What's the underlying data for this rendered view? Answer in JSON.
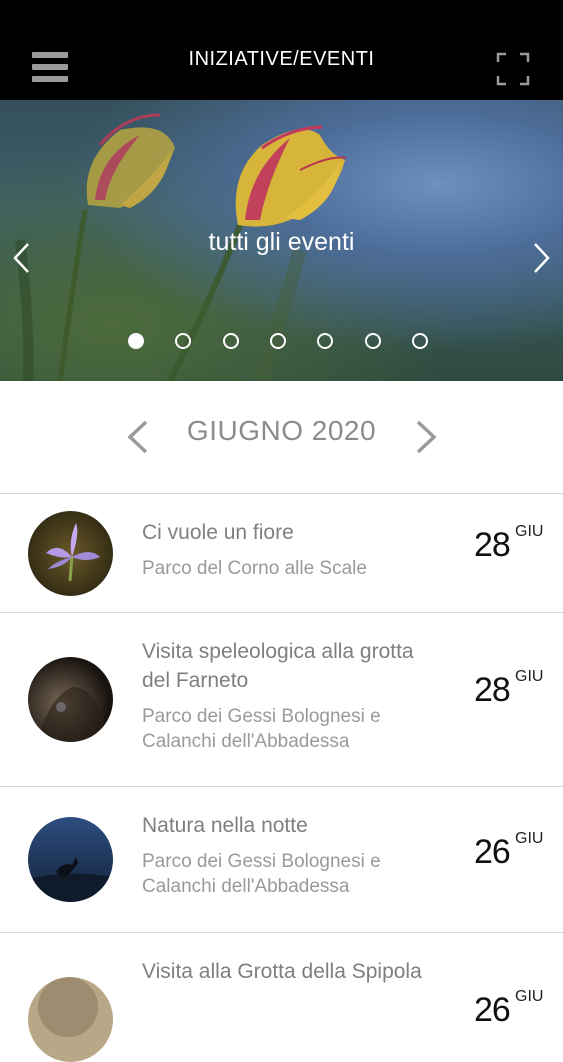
{
  "header": {
    "title": "INIZIATIVE/EVENTI",
    "menu_icon": "hamburger-menu-icon",
    "fullscreen_icon": "fullscreen-icon"
  },
  "hero": {
    "caption": "tutti gli eventi",
    "slide_count": 7,
    "active_slide": 1
  },
  "calendar": {
    "month_label": "GIUGNO 2020"
  },
  "events": [
    {
      "title": "Ci vuole un fiore",
      "place": "Parco del Corno alle Scale",
      "day": "28",
      "month": "GIU"
    },
    {
      "title": "Visita speleologica alla grotta del Farneto",
      "place": "Parco dei Gessi Bolognesi e Calanchi dell'Abbadessa",
      "day": "28",
      "month": "GIU"
    },
    {
      "title": "Natura nella notte",
      "place": "Parco dei Gessi Bolognesi e Calanchi dell'Abbadessa",
      "day": "26",
      "month": "GIU"
    },
    {
      "title": "Visita alla Grotta della Spipola",
      "place": "",
      "day": "26",
      "month": "GIU"
    }
  ],
  "colors": {
    "header_bg": "#000000",
    "text_primary": "#7f7f7f",
    "divider": "#d9d9d9"
  }
}
